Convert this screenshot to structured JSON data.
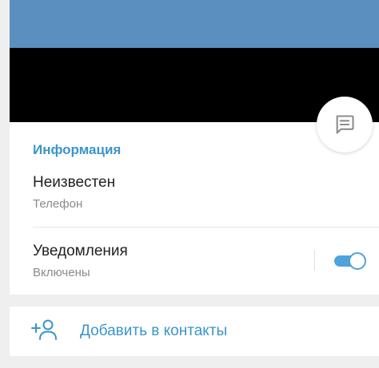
{
  "colors": {
    "header": "#5b8fc0",
    "accent": "#3a95c9",
    "toggle_on": "#4fa3dc",
    "section_gap": "#efefef"
  },
  "fab": {
    "icon": "message-icon"
  },
  "info": {
    "title": "Информация",
    "phone": {
      "value": "Неизвестен",
      "label": "Телефон"
    },
    "notifications": {
      "title": "Уведомления",
      "status": "Включены",
      "enabled": true
    }
  },
  "actions": {
    "add_contact": {
      "icon": "add-user-icon",
      "label": "Добавить в контакты"
    }
  }
}
